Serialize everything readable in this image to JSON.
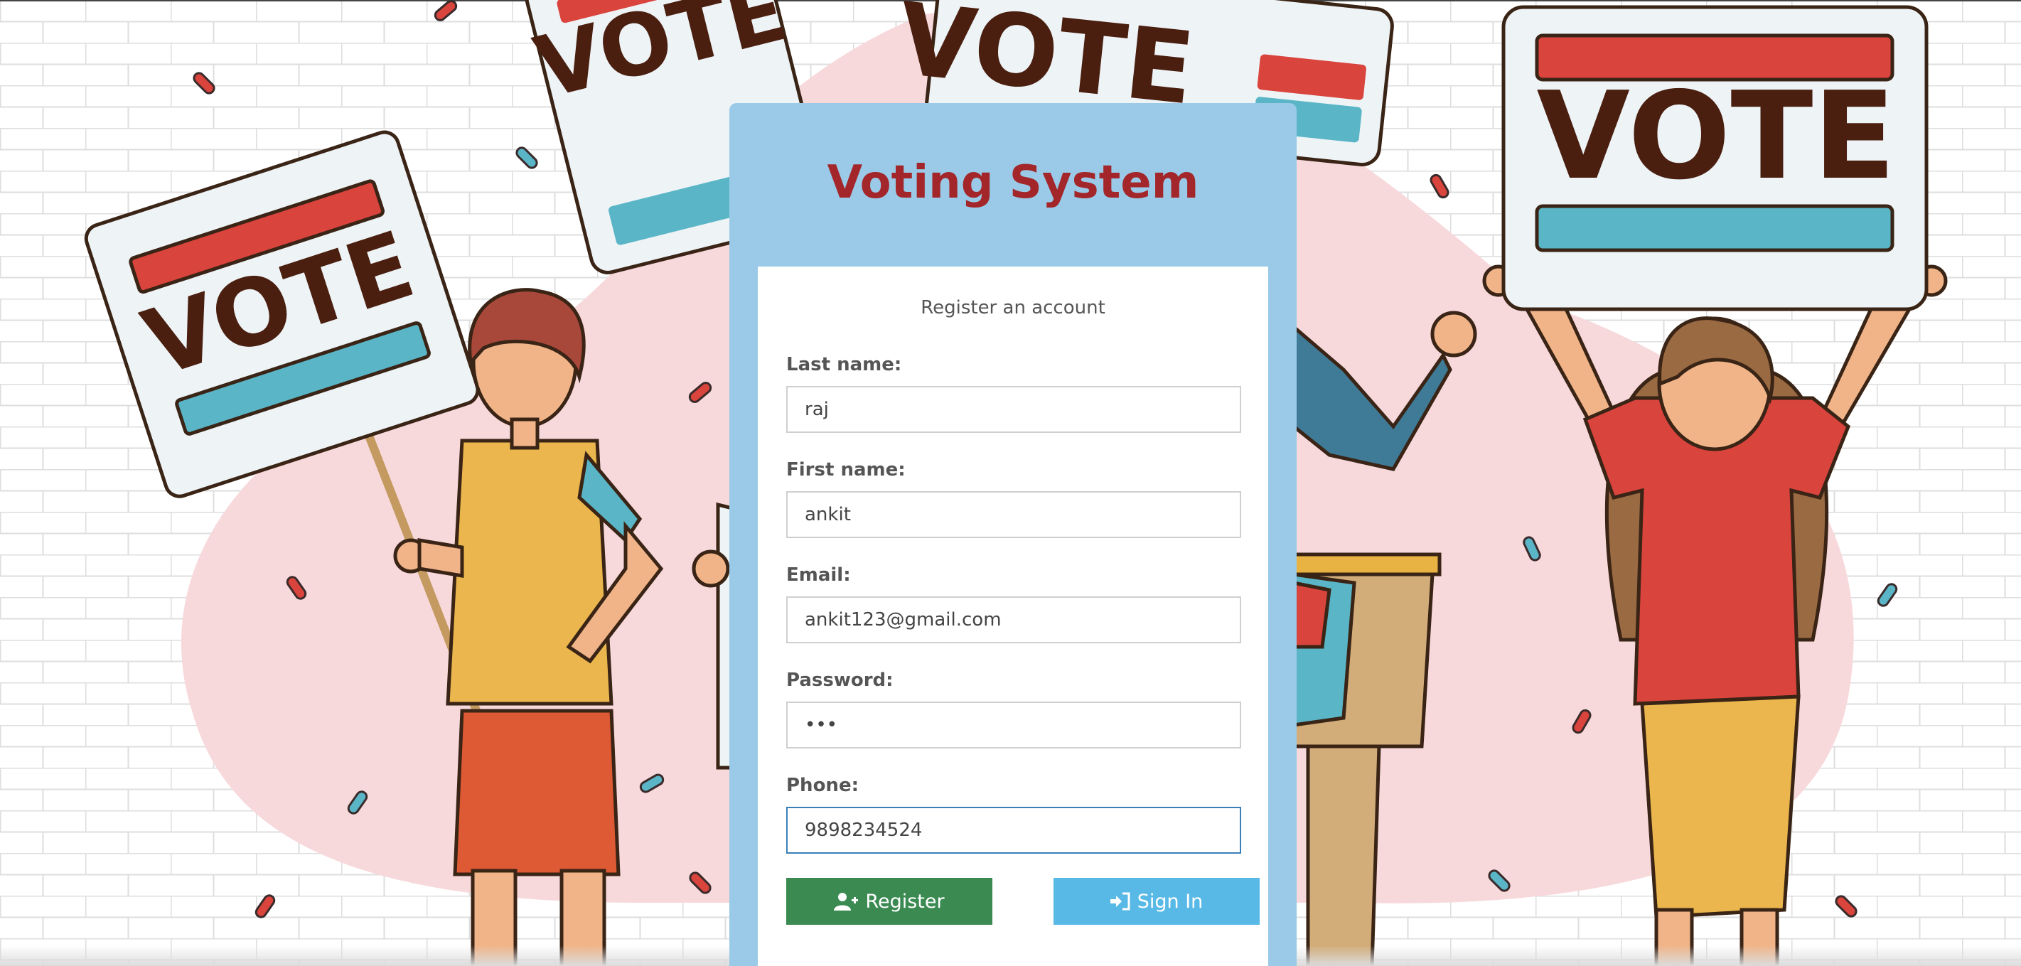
{
  "app": {
    "title": "Voting System",
    "subtitle": "Register an account"
  },
  "background": {
    "signs": [
      "VOTE",
      "VOTE",
      "VOTE",
      "VOTE"
    ],
    "accent_red": "#d9443d",
    "accent_teal": "#5ab5c7",
    "blob_pink": "#f7d9dc"
  },
  "form": {
    "fields": [
      {
        "label": "Last name:",
        "value": "raj",
        "type": "text"
      },
      {
        "label": "First name:",
        "value": "ankit",
        "type": "text"
      },
      {
        "label": "Email:",
        "value": "ankit123@gmail.com",
        "type": "email"
      },
      {
        "label": "Password:",
        "value": "•••",
        "type": "password"
      },
      {
        "label": "Phone:",
        "value": "9898234524",
        "type": "tel",
        "focused": true
      }
    ],
    "register_label": "Register",
    "signin_label": "Sign In",
    "register_color": "#3a8a52",
    "signin_color": "#58b9e6"
  }
}
